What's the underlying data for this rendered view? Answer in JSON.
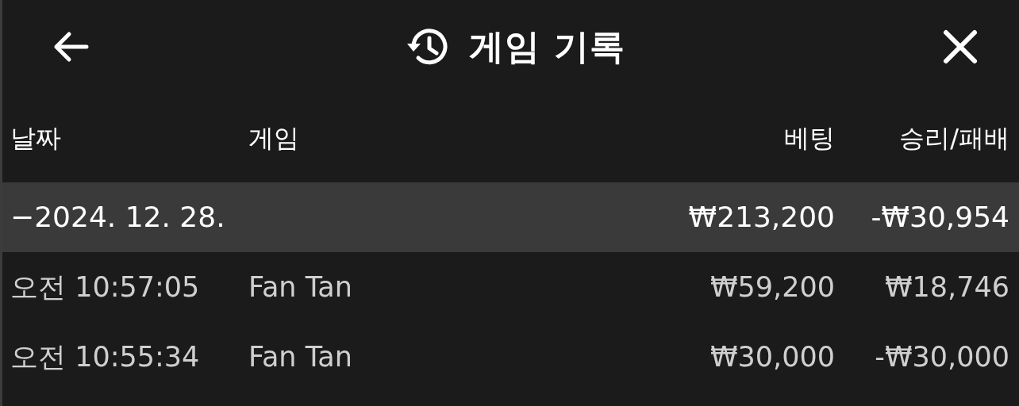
{
  "header": {
    "title": "게임 기록"
  },
  "columns": [
    "날짜",
    "게임",
    "베팅",
    "승리/패배"
  ],
  "groups": [
    {
      "toggle": "−",
      "date": "2024. 12. 28.",
      "bet": "₩213,200",
      "result": "-₩30,954",
      "rows": [
        {
          "time": "오전 10:57:05",
          "game": "Fan Tan",
          "bet": "₩59,200",
          "result": "₩18,746"
        },
        {
          "time": "오전 10:55:34",
          "game": "Fan Tan",
          "bet": "₩30,000",
          "result": "-₩30,000"
        }
      ]
    }
  ]
}
